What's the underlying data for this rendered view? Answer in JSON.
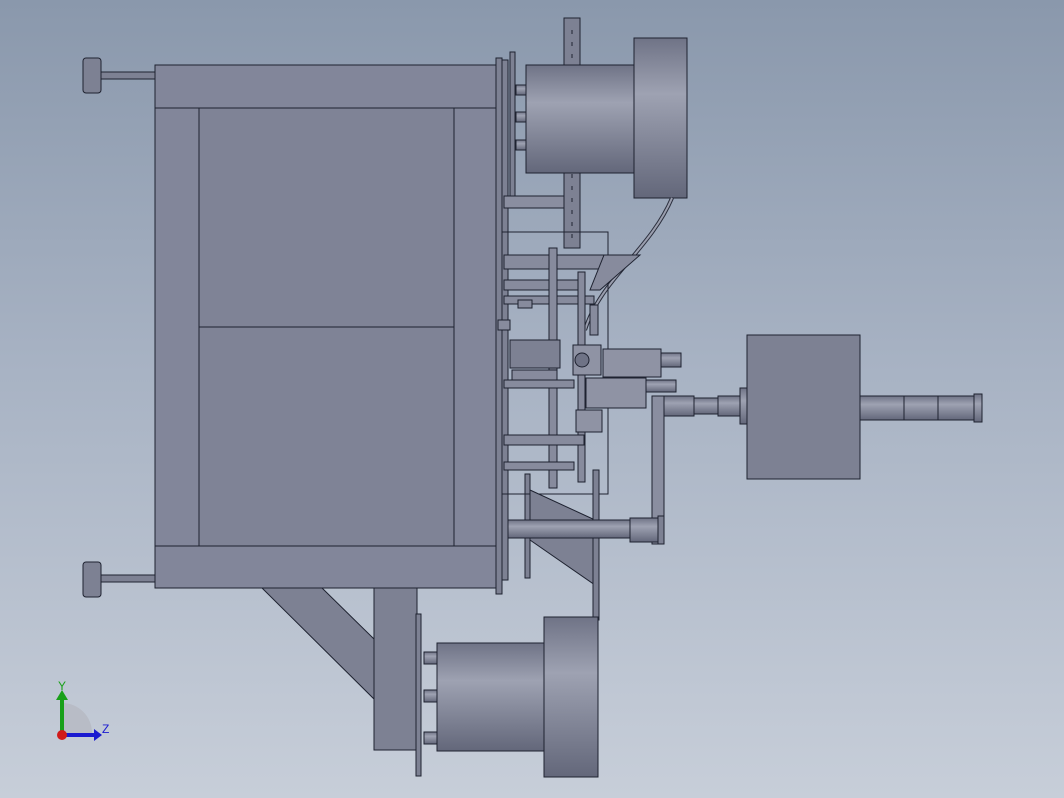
{
  "viewport": {
    "background_top": "#8a98ac",
    "background_bottom": "#c7ced9",
    "part_fill": "#7d8193",
    "part_fill_light": "#9a9eae",
    "edge_color": "#1e2230"
  },
  "triad": {
    "y_label": "Y",
    "z_label": "Z",
    "y_color": "#19a019",
    "z_color": "#1a1ad0",
    "x_color": "#d01a1a"
  }
}
